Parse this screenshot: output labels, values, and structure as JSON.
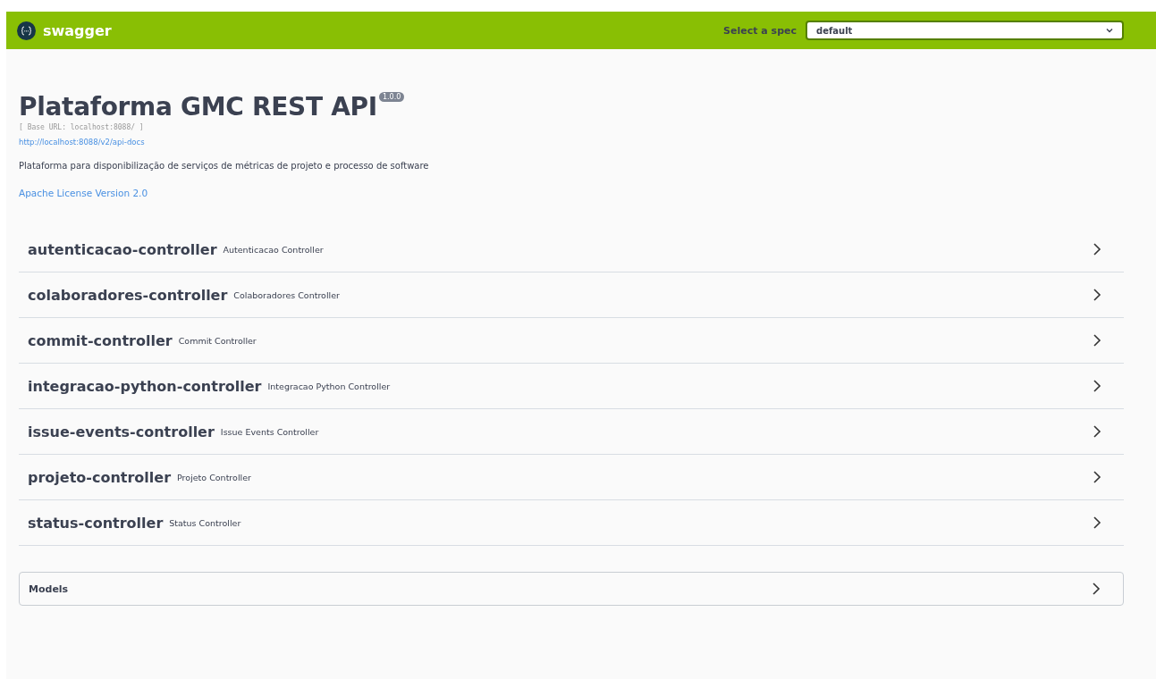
{
  "topbar": {
    "brand": "swagger",
    "spec_label": "Select a spec",
    "spec_value": "default"
  },
  "info": {
    "title": "Plataforma GMC REST API",
    "version": "1.0.0",
    "base_url": "[ Base URL: localhost:8088/ ]",
    "docs_link": "http://localhost:8088/v2/api-docs",
    "description": "Plataforma para disponibilização de serviços de métricas de projeto e processo de software",
    "license": "Apache License Version 2.0"
  },
  "controllers": [
    {
      "name": "autenticacao-controller",
      "description": "Autenticacao Controller",
      "expanded": false
    },
    {
      "name": "colaboradores-controller",
      "description": "Colaboradores Controller",
      "expanded": false
    },
    {
      "name": "commit-controller",
      "description": "Commit Controller",
      "expanded": false
    },
    {
      "name": "integracao-python-controller",
      "description": "Integracao Python Controller",
      "expanded": false
    },
    {
      "name": "issue-events-controller",
      "description": "Issue Events Controller",
      "expanded": false
    },
    {
      "name": "projeto-controller",
      "description": "Projeto Controller",
      "expanded": false
    },
    {
      "name": "status-controller",
      "description": "Status Controller",
      "expanded": false
    }
  ],
  "models": {
    "title": "Models",
    "expanded": false
  }
}
